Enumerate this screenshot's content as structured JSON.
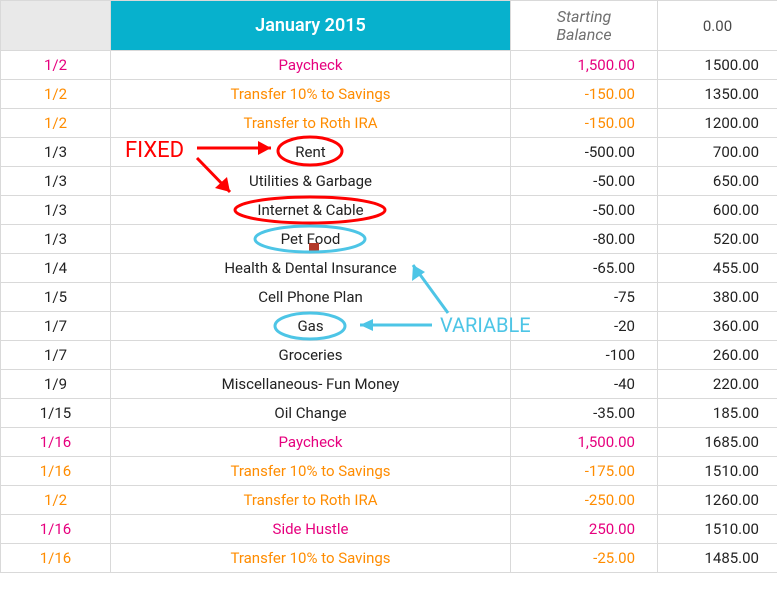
{
  "header": {
    "month_label": "January 2015",
    "starting_balance_label": "Starting\nBalance",
    "starting_balance_value": "0.00"
  },
  "rows": [
    {
      "date": "1/2",
      "desc": "Paycheck",
      "amount": "1,500.00",
      "balance": "1500.00",
      "tone": "pink"
    },
    {
      "date": "1/2",
      "desc": "Transfer 10% to Savings",
      "amount": "-150.00",
      "balance": "1350.00",
      "tone": "orange"
    },
    {
      "date": "1/2",
      "desc": "Transfer to Roth IRA",
      "amount": "-150.00",
      "balance": "1200.00",
      "tone": "orange"
    },
    {
      "date": "1/3",
      "desc": "Rent",
      "amount": "-500.00",
      "balance": "700.00",
      "tone": "plain"
    },
    {
      "date": "1/3",
      "desc": "Utilities & Garbage",
      "amount": "-50.00",
      "balance": "650.00",
      "tone": "plain"
    },
    {
      "date": "1/3",
      "desc": "Internet & Cable",
      "amount": "-50.00",
      "balance": "600.00",
      "tone": "plain"
    },
    {
      "date": "1/3",
      "desc": "Pet Food",
      "amount": "-80.00",
      "balance": "520.00",
      "tone": "plain"
    },
    {
      "date": "1/4",
      "desc": "Health & Dental Insurance",
      "amount": "-65.00",
      "balance": "455.00",
      "tone": "plain"
    },
    {
      "date": "1/5",
      "desc": "Cell Phone Plan",
      "amount": "-75",
      "balance": "380.00",
      "tone": "plain"
    },
    {
      "date": "1/7",
      "desc": "Gas",
      "amount": "-20",
      "balance": "360.00",
      "tone": "plain"
    },
    {
      "date": "1/7",
      "desc": "Groceries",
      "amount": "-100",
      "balance": "260.00",
      "tone": "plain"
    },
    {
      "date": "1/9",
      "desc": "Miscellaneous- Fun Money",
      "amount": "-40",
      "balance": "220.00",
      "tone": "plain"
    },
    {
      "date": "1/15",
      "desc": "Oil Change",
      "amount": "-35.00",
      "balance": "185.00",
      "tone": "plain"
    },
    {
      "date": "1/16",
      "desc": "Paycheck",
      "amount": "1,500.00",
      "balance": "1685.00",
      "tone": "pink"
    },
    {
      "date": "1/16",
      "desc": "Transfer 10% to Savings",
      "amount": "-175.00",
      "balance": "1510.00",
      "tone": "orange"
    },
    {
      "date": "1/2",
      "desc": "Transfer to Roth IRA",
      "amount": "-250.00",
      "balance": "1260.00",
      "tone": "orange"
    },
    {
      "date": "1/16",
      "desc": "Side Hustle",
      "amount": "250.00",
      "balance": "1510.00",
      "tone": "pink"
    },
    {
      "date": "1/16",
      "desc": "Transfer 10% to Savings",
      "amount": "-25.00",
      "balance": "1485.00",
      "tone": "orange"
    }
  ],
  "annotations": {
    "fixed_label": "FIXED",
    "variable_label": "VARIABLE",
    "colors": {
      "fixed": "#ff0000",
      "variable": "#4dc5e6"
    }
  }
}
